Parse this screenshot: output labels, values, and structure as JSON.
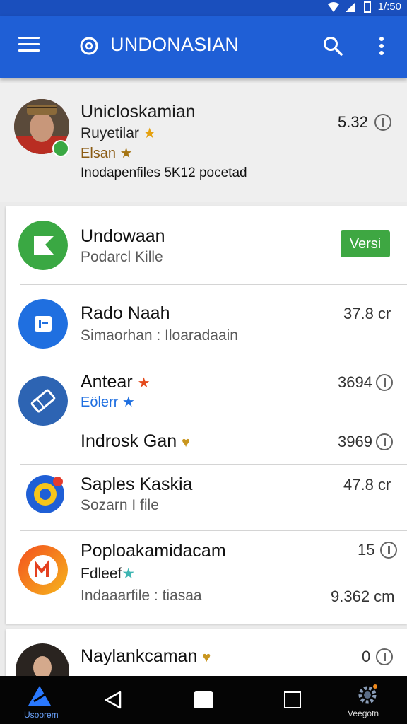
{
  "status": {
    "time": "1/:50"
  },
  "appbar": {
    "title": "UNDONASIAN",
    "icons": [
      "menu-icon",
      "app-logo-icon",
      "search-icon",
      "more-vert-icon"
    ]
  },
  "profile": {
    "name": "Unicloskamian",
    "line1": "Ruyetilar",
    "line2": "Elsan",
    "line3": "Inodapenfiles 5K12 pocetad",
    "value": "5.32"
  },
  "list": [
    {
      "title": "Undowaan",
      "subtitle": "Podarcl Kille",
      "badge": "Versi"
    },
    {
      "title": "Rado Naah",
      "subtitle": "Simaorhan : Iloaradaain",
      "value": "37.8 cr"
    },
    {
      "title": "Antear",
      "subtitle": "Eölerr",
      "value": "3694"
    },
    {
      "title": "Indrosk Gan",
      "value": "3969"
    },
    {
      "title": "Saples Kaskia",
      "subtitle": "Sozarn I file",
      "value": "47.8 cr"
    },
    {
      "title": "Poploakamidacam",
      "subtitle": "Fdleef",
      "line3": "Indaaarfile : tiasaa",
      "value": "15",
      "value2": "9.362 cm"
    },
    {
      "title": "Naylankcaman",
      "value": "0"
    }
  ],
  "navbar": {
    "left_label": "Usoorem",
    "right_label": "Veegotn"
  },
  "colors": {
    "appbar": "#1f5fd6",
    "accent_green": "#3ea742",
    "star": "#e5a10f"
  }
}
